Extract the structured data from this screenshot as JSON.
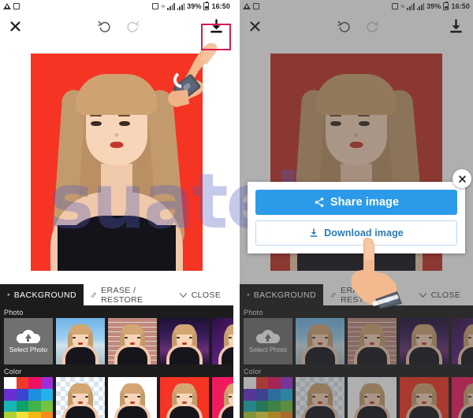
{
  "status_bar": {
    "battery_percent": "39%",
    "time": "16:50",
    "icons": [
      "warning-icon",
      "sim-icon",
      "alarm-icon",
      "wifi-icon",
      "signal-icon",
      "signal2-icon",
      "battery-icon"
    ]
  },
  "toolbar": {
    "close_icon": "close-icon",
    "undo_icon": "undo-icon",
    "redo_icon": "redo-icon",
    "download_icon": "download-icon"
  },
  "highlight": {
    "color": "#d81b55",
    "target": "download-button"
  },
  "editor": {
    "tabs": [
      {
        "label": "BACKGROUND",
        "icon": "layers-icon",
        "active": true
      },
      {
        "label": "ERASE / RESTORE",
        "icon": "eraser-icon",
        "active": false
      },
      {
        "label": "CLOSE",
        "icon": "chevron-down-icon",
        "active": false
      }
    ],
    "photo_section": {
      "label": "Photo",
      "select_photo_label": "Select Photo",
      "select_photo_icon": "cloud-upload-icon",
      "thumbnails": [
        "beach",
        "brick-wall",
        "city-night",
        "purple-light",
        "extra"
      ]
    },
    "color_section": {
      "label": "Color",
      "palette_colors": [
        "#ffffff",
        "#f0372b",
        "#ee1164",
        "#9b30d9",
        "#6a2fd0",
        "#3b46cc",
        "#1f8fe0",
        "#23b3e8",
        "#17b3b8",
        "#12a06a",
        "#3fb24a",
        "#74c23f",
        "#aed136",
        "#f2e03a",
        "#f5b712",
        "#f58a1f"
      ],
      "thumbnails": [
        "transparent-checker",
        "white",
        "red",
        "pink"
      ]
    }
  },
  "dialog": {
    "share_label": "Share image",
    "share_icon": "share-icon",
    "download_label": "Download image",
    "download_icon": "download-icon",
    "close_icon": "close-icon",
    "accent_color": "#2b9ae8"
  },
  "watermark": {
    "text": "suatekno"
  },
  "canvas": {
    "left_background_color": "#f53424",
    "right_background_color": "#c2332a"
  }
}
